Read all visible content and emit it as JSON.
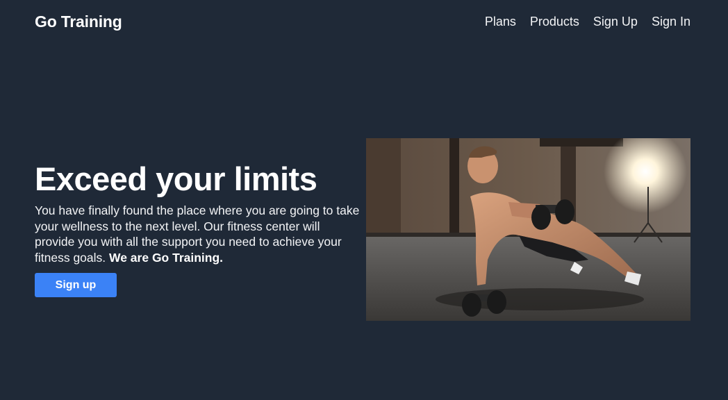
{
  "navbar": {
    "brand": "Go Training",
    "links": [
      {
        "label": "Plans"
      },
      {
        "label": "Products"
      },
      {
        "label": "Sign Up"
      },
      {
        "label": "Sign In"
      }
    ]
  },
  "hero": {
    "title": "Exceed your limits",
    "description": "You have finally found the place where you are going to take your wellness to the next level. Our fitness center will provide you with all the support you need to achieve your fitness goals.",
    "description_emphasis": "We are Go Training.",
    "cta_label": "Sign up",
    "image": {
      "subject": "man-doing-dumbbell-row-plank-photo"
    }
  },
  "colors": {
    "background": "#1f2937",
    "accent": "#3b82f6",
    "text": "#f3f4f6"
  }
}
